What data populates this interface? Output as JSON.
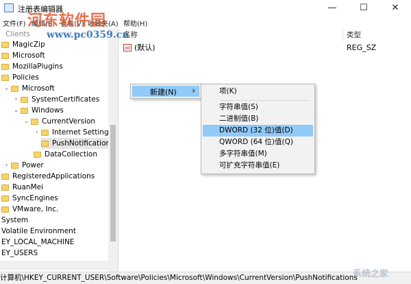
{
  "window": {
    "title": "注册表编辑器",
    "minimize": "—",
    "maximize": "☐",
    "close": "✕"
  },
  "menubar": {
    "items": [
      "文件(F)",
      "编辑(E)",
      "查看(V)",
      "收藏夹(A)",
      "帮助(H)"
    ]
  },
  "watermark": {
    "text": "河东软件园",
    "url": "www.pc0359.cn",
    "corner": "系统之家"
  },
  "tree": {
    "items": [
      {
        "label": "Clients",
        "chev": ""
      },
      {
        "label": "MagicZip",
        "chev": ""
      },
      {
        "label": "Microsoft",
        "chev": ""
      },
      {
        "label": "MozillaPlugins",
        "chev": ""
      },
      {
        "label": "Policies",
        "chev": ""
      },
      {
        "label": "Microsoft",
        "chev": "⌄"
      },
      {
        "label": "SystemCertificates",
        "chev": "›"
      },
      {
        "label": "Windows",
        "chev": "⌄"
      },
      {
        "label": "CurrentVersion",
        "chev": "⌄"
      },
      {
        "label": "Internet Settings",
        "chev": "›"
      },
      {
        "label": "PushNotifications",
        "chev": ""
      },
      {
        "label": "DataCollection",
        "chev": ""
      },
      {
        "label": "Power",
        "chev": "›"
      },
      {
        "label": "RegisteredApplications",
        "chev": ""
      },
      {
        "label": "RuanMei",
        "chev": ""
      },
      {
        "label": "SyncEngines",
        "chev": ""
      },
      {
        "label": "VMware, Inc.",
        "chev": ""
      },
      {
        "label": "System",
        "chev": ""
      },
      {
        "label": "Volatile Environment",
        "chev": ""
      },
      {
        "label": "EY_LOCAL_MACHINE",
        "chev": ""
      },
      {
        "label": "EY_USERS",
        "chev": ""
      }
    ]
  },
  "list": {
    "col_name": "名称",
    "col_type": "类型",
    "rows": [
      {
        "icon": "ab",
        "name": "(默认)",
        "type": "REG_SZ"
      }
    ]
  },
  "context_menu": {
    "new_label": "新建(N)",
    "arrow": "›",
    "submenu": [
      "项(K)",
      "字符串值(S)",
      "二进制值(B)",
      "DWORD (32 位)值(D)",
      "QWORD (64 位)值(Q)",
      "多字符串值(M)",
      "可扩充字符串值(E)"
    ],
    "highlighted_index": 3
  },
  "status": {
    "path": "计算机\\HKEY_CURRENT_USER\\Software\\Policies\\Microsoft\\Windows\\CurrentVersion\\PushNotifications"
  }
}
